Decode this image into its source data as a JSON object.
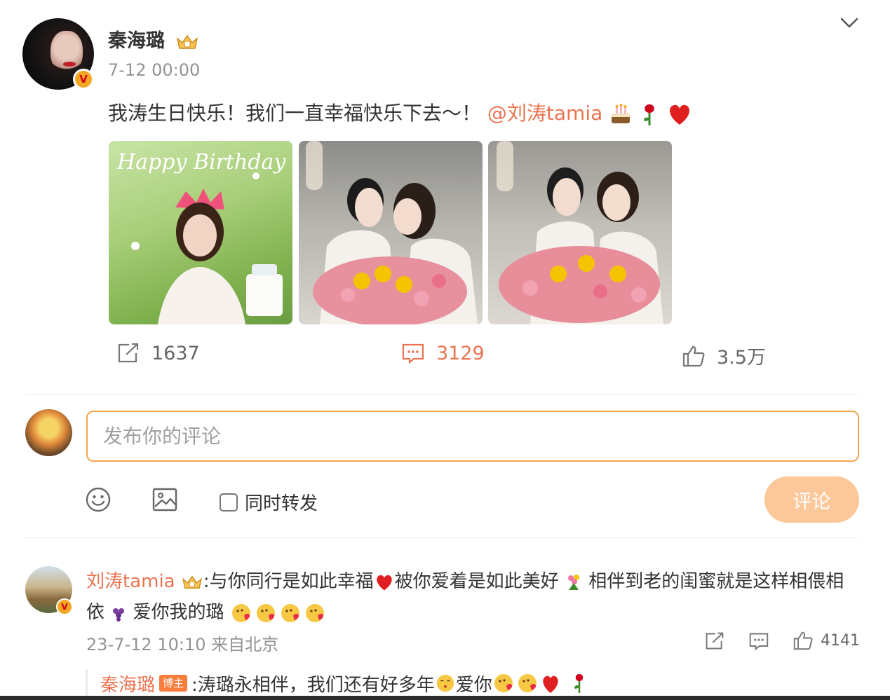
{
  "post": {
    "author": "秦海璐",
    "time": "7-12 00:00",
    "text": "我涛生日快乐！我们一直幸福快乐下去～！",
    "mention": "@刘涛tamia",
    "photo_caption": "Happy Birthday"
  },
  "actions": {
    "repost_count": "1637",
    "comment_count": "3129",
    "like_count": "3.5万"
  },
  "composer": {
    "placeholder": "发布你的评论",
    "repost_label": "同时转发",
    "submit_label": "评论"
  },
  "comments": [
    {
      "author": "刘涛tamia",
      "text_part1": ":与你同行是如此幸福",
      "text_part2": "被你爱着是如此美好",
      "text_part3": "相伴到老的闺蜜就是这样相偎相",
      "text_part4": "依",
      "text_part5": "爱你我的璐",
      "meta": "23-7-12 10:10 来自北京",
      "like_count": "4141"
    }
  ],
  "reply": {
    "author": "秦海璐",
    "badge": "博主",
    "text_part1": ":涛璐永相伴，我们还有好多年",
    "text_part2": "爱你"
  },
  "colors": {
    "accent": "#eb7350",
    "input_border": "#f7a54a",
    "button_disabled": "#fcc89a",
    "muted": "#939393"
  }
}
